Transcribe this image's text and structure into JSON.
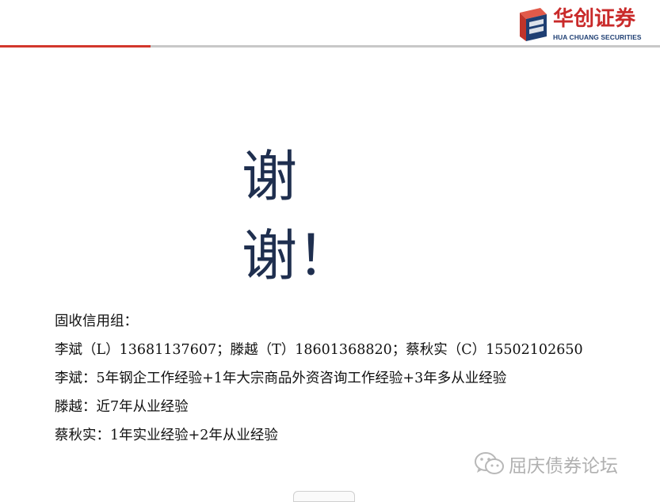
{
  "brand": {
    "name_cn": "华创证券",
    "name_en": "HUA CHUANG SECURITIES",
    "colors": {
      "red": "#d2372c",
      "navy": "#1f3f73"
    }
  },
  "slide": {
    "thanks_line1": "谢",
    "thanks_line2": "谢！"
  },
  "team": {
    "title": "固收信用组：",
    "contacts_line": "李斌（L）13681137607；滕越（T）18601368820；蔡秋实（C）15502102650",
    "bios": [
      "李斌：5年钢企工作经验+1年大宗商品外资咨询工作经验+3年多从业经验",
      "滕越：近7年从业经验",
      "蔡秋实：1年实业经验+2年从业经验"
    ]
  },
  "watermark": {
    "icon": "wechat-icon",
    "text": "屈庆债券论坛"
  }
}
